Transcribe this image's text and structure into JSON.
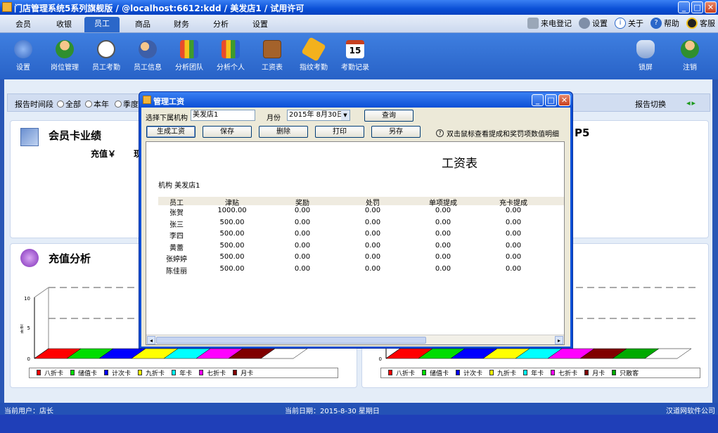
{
  "window": {
    "title": "门店管理系统5系列旗舰版 / @localhost:6612:kdd / 美发店1 / 试用许可",
    "controls": {
      "minimize": "_",
      "maximize": "□",
      "close": "✕"
    }
  },
  "menu": {
    "tabs": [
      "会员",
      "收银",
      "员工",
      "商品",
      "财务",
      "分析",
      "设置"
    ],
    "active": "员工",
    "right": [
      "来电登记",
      "设置",
      "关于",
      "帮助",
      "客服"
    ]
  },
  "ribbon": {
    "items": [
      "设置",
      "岗位管理",
      "员工考勤",
      "员工信息",
      "分析团队",
      "分析个人",
      "工资表",
      "指纹考勤",
      "考勤记录"
    ],
    "calendar_day": "15",
    "right_items": [
      "锁屏",
      "注销"
    ]
  },
  "filter": {
    "label": "报告时间段",
    "options": [
      "全部",
      "本年",
      "季度"
    ],
    "switch_label": "报告切换"
  },
  "panels": {
    "member_card": {
      "title": "会员卡业绩",
      "recharge_label": "充值￥",
      "trailing_glyph": "现",
      "right_title": "P5"
    },
    "recharge": {
      "title": "充值分析"
    }
  },
  "charts": {
    "left": {
      "y_ticks": [
        "10",
        "5",
        "0"
      ],
      "ylabel": "金额",
      "legend": [
        "八折卡",
        "储值卡",
        "计次卡",
        "九折卡",
        "年卡",
        "七折卡",
        "月卡"
      ],
      "colors": [
        "#ff0000",
        "#00dd00",
        "#0000ff",
        "#ffff00",
        "#00ffff",
        "#ff00ff",
        "#800000"
      ]
    },
    "right": {
      "y_ticks": [
        "0"
      ],
      "legend": [
        "八折卡",
        "储值卡",
        "计次卡",
        "九折卡",
        "年卡",
        "七折卡",
        "月卡",
        "只散客"
      ],
      "colors": [
        "#ff0000",
        "#00dd00",
        "#0000ff",
        "#ffff00",
        "#00ffff",
        "#ff00ff",
        "#800000",
        "#00aa00"
      ]
    }
  },
  "dialog": {
    "title": "管理工资",
    "org_label": "选择下属机构",
    "org_value": "美发店1",
    "month_label": "月份",
    "month_value": "2015年 8月30日",
    "query_button": "查询",
    "buttons": [
      "生成工资",
      "保存",
      "删除",
      "打印",
      "另存"
    ],
    "hint": "双击鼠标查看提成和奖罚项数值明细",
    "report": {
      "title": "工资表",
      "org_line": "机构  美发店1",
      "columns": [
        "员工",
        "津贴",
        "奖励",
        "处罚",
        "单项提成",
        "充卡提成"
      ],
      "rows": [
        [
          "张贺",
          "1000.00",
          "0.00",
          "0.00",
          "0.00",
          "0.00"
        ],
        [
          "张三",
          "500.00",
          "0.00",
          "0.00",
          "0.00",
          "0.00"
        ],
        [
          "李四",
          "500.00",
          "0.00",
          "0.00",
          "0.00",
          "0.00"
        ],
        [
          "黄蕾",
          "500.00",
          "0.00",
          "0.00",
          "0.00",
          "0.00"
        ],
        [
          "张婷婷",
          "500.00",
          "0.00",
          "0.00",
          "0.00",
          "0.00"
        ],
        [
          "陈佳丽",
          "500.00",
          "0.00",
          "0.00",
          "0.00",
          "0.00"
        ]
      ]
    }
  },
  "status": {
    "user": "当前用户：店长",
    "date": "当前日期：2015-8-30  星期日",
    "company": "汉道网软件公司"
  },
  "colors": {
    "titlebar": "#0a4fd6",
    "ribbon": "#2f6bd0",
    "active_tab": "#2b67c9"
  }
}
